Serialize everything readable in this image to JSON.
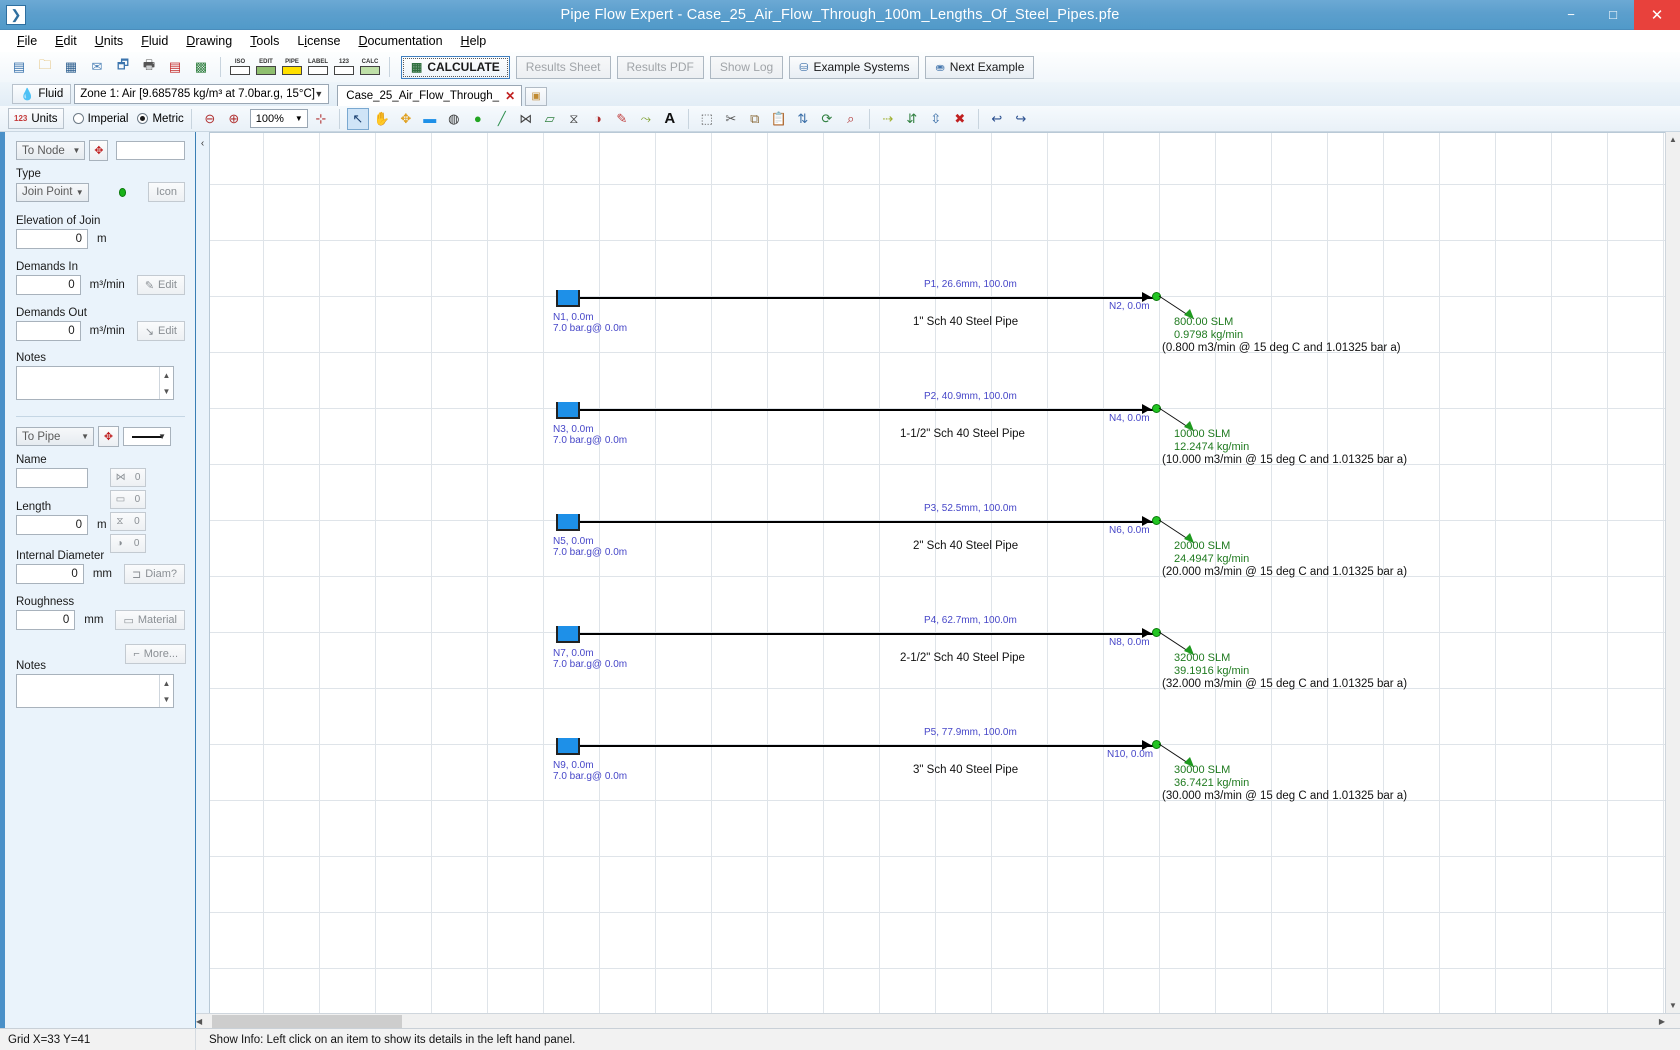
{
  "window": {
    "app_icon": "app-icon",
    "title": "Pipe Flow Expert - Case_25_Air_Flow_Through_100m_Lengths_Of_Steel_Pipes.pfe",
    "minimize": "−",
    "maximize": "□",
    "close": "✕"
  },
  "menubar": {
    "items": [
      {
        "label": "File",
        "accel": "F"
      },
      {
        "label": "Edit",
        "accel": "E"
      },
      {
        "label": "Units",
        "accel": "U"
      },
      {
        "label": "Fluid",
        "accel": "F"
      },
      {
        "label": "Drawing",
        "accel": "D"
      },
      {
        "label": "Tools",
        "accel": "T"
      },
      {
        "label": "License",
        "accel": "i"
      },
      {
        "label": "Documentation",
        "accel": "D"
      },
      {
        "label": "Help",
        "accel": "H"
      }
    ]
  },
  "toolbar": {
    "file_icons": [
      {
        "name": "new-document-icon",
        "glyph": "▤"
      },
      {
        "name": "open-folder-icon",
        "glyph": "📂"
      },
      {
        "name": "save-icon",
        "glyph": "💾"
      },
      {
        "name": "email-icon",
        "glyph": "✉"
      },
      {
        "name": "export-icon",
        "glyph": "🗔"
      },
      {
        "name": "print-icon",
        "glyph": "🖨"
      },
      {
        "name": "pdf-icon",
        "glyph": "▣"
      },
      {
        "name": "image-export-icon",
        "glyph": "🖼"
      }
    ],
    "grid_icons": [
      {
        "name": "iso-view-icon",
        "label": "ISO"
      },
      {
        "name": "edit-grid-icon",
        "label": "EDIT"
      },
      {
        "name": "pipe-grid-icon",
        "label": "PIPE"
      },
      {
        "name": "label-grid-icon",
        "label": "LABEL"
      },
      {
        "name": "numbers-grid-icon",
        "label": "123"
      },
      {
        "name": "calc-grid-icon",
        "label": "CALC"
      }
    ],
    "calculate_label": "CALCULATE",
    "results_sheet_label": "Results Sheet",
    "results_pdf_label": "Results PDF",
    "show_log_label": "Show Log",
    "example_systems_label": "Example Systems",
    "next_example_label": "Next Example"
  },
  "fluidbar": {
    "fluid_button_label": "Fluid",
    "zone_value": "Zone 1: Air [9.685785 kg/m³ at 7.0bar.g, 15°C]",
    "document_tab_label": "Case_25_Air_Flow_Through_",
    "document_tab_close": "✕",
    "new_tab_glyph": "▣"
  },
  "viewbar": {
    "units_button_label": "Units",
    "imperial_label": "Imperial",
    "metric_label": "Metric",
    "units_selected": "Metric",
    "zoom_value": "100%",
    "tools": [
      {
        "name": "zoom-out-icon",
        "glyph": "⊖"
      },
      {
        "name": "zoom-in-icon",
        "glyph": "⊕"
      },
      {
        "name": "fit-to-window-icon",
        "glyph": "⊹"
      },
      {
        "name": "select-pointer-icon",
        "glyph": "↖"
      },
      {
        "name": "pan-hand-icon",
        "glyph": "✋"
      },
      {
        "name": "move-node-icon",
        "glyph": "✥"
      },
      {
        "name": "tank-tool-icon",
        "glyph": "▬"
      },
      {
        "name": "pressure-node-icon",
        "glyph": "◍"
      },
      {
        "name": "join-point-icon",
        "glyph": "●"
      },
      {
        "name": "pipe-tool-icon",
        "glyph": "╱"
      },
      {
        "name": "valve-tool-icon",
        "glyph": "⋈"
      },
      {
        "name": "component-tool-icon",
        "glyph": "▱"
      },
      {
        "name": "fitting-tool-icon",
        "glyph": "⧖"
      },
      {
        "name": "pump-tool-icon",
        "glyph": "◑"
      },
      {
        "name": "pencil-tool-icon",
        "glyph": "✎"
      },
      {
        "name": "flow-arrow-icon",
        "glyph": "⤳"
      },
      {
        "name": "text-tool-icon",
        "glyph": "A"
      },
      {
        "name": "marquee-select-icon",
        "glyph": "⬚"
      },
      {
        "name": "cut-icon",
        "glyph": "✂"
      },
      {
        "name": "copy-icon",
        "glyph": "⧉"
      },
      {
        "name": "paste-icon",
        "glyph": "📋"
      },
      {
        "name": "mirror-icon",
        "glyph": "⇅"
      },
      {
        "name": "rotate-icon",
        "glyph": "⟳"
      },
      {
        "name": "zoom-region-icon",
        "glyph": "🔍"
      },
      {
        "name": "align-horizontal-icon",
        "glyph": "⇢"
      },
      {
        "name": "align-vertical-icon",
        "glyph": "⇵"
      },
      {
        "name": "distribute-icon",
        "glyph": "⇳"
      },
      {
        "name": "delete-icon",
        "glyph": "✖"
      },
      {
        "name": "undo-icon",
        "glyph": "↩"
      },
      {
        "name": "redo-icon",
        "glyph": "↪"
      }
    ]
  },
  "node_panel": {
    "selector_label": "To Node",
    "name_value": "",
    "type_label": "Type",
    "type_value": "Join Point",
    "icon_button_label": "Icon",
    "elevation_label": "Elevation of Join",
    "elevation_value": "0",
    "elevation_unit": "m",
    "demands_in_label": "Demands In",
    "demands_in_value": "0",
    "demands_in_unit": "m³/min",
    "demands_in_edit": "Edit",
    "demands_out_label": "Demands Out",
    "demands_out_value": "0",
    "demands_out_unit": "m³/min",
    "demands_out_edit": "Edit",
    "notes_label": "Notes",
    "notes_value": ""
  },
  "pipe_panel": {
    "selector_label": "To Pipe",
    "name_label": "Name",
    "name_value": "",
    "length_label": "Length",
    "length_value": "0",
    "length_unit": "m",
    "diameter_label": "Internal Diameter",
    "diameter_value": "0",
    "diameter_unit": "mm",
    "diameter_button": "Diam?",
    "roughness_label": "Roughness",
    "roughness_value": "0",
    "roughness_unit": "mm",
    "material_button": "Material",
    "more_button": "More...",
    "notes_label": "Notes",
    "notes_value": "",
    "counters": [
      {
        "name": "fittings-count",
        "value": "0"
      },
      {
        "name": "components-count",
        "value": "0"
      },
      {
        "name": "valves-count",
        "value": "0"
      },
      {
        "name": "pumps-count",
        "value": "0"
      }
    ]
  },
  "drawing": {
    "rows": [
      {
        "pipe_label": "P1, 26.6mm, 100.0m",
        "description": "1\" Sch 40 Steel Pipe",
        "start_node": "N1, 0.0m",
        "start_pressure": "7.0 bar.g@ 0.0m",
        "end_node": "N2, 0.0m",
        "flow_slm": "800.00 SLM",
        "flow_kgmin": "0.9798 kg/min",
        "flow_conditions": "(0.800 m3/min @ 15 deg C and 1.01325 bar a)"
      },
      {
        "pipe_label": "P2, 40.9mm, 100.0m",
        "description": "1-1/2\" Sch 40 Steel Pipe",
        "start_node": "N3, 0.0m",
        "start_pressure": "7.0 bar.g@ 0.0m",
        "end_node": "N4, 0.0m",
        "flow_slm": "10000 SLM",
        "flow_kgmin": "12.2474 kg/min",
        "flow_conditions": "(10.000 m3/min @ 15 deg C and 1.01325 bar a)"
      },
      {
        "pipe_label": "P3, 52.5mm, 100.0m",
        "description": "2\" Sch 40 Steel Pipe",
        "start_node": "N5, 0.0m",
        "start_pressure": "7.0 bar.g@ 0.0m",
        "end_node": "N6, 0.0m",
        "flow_slm": "20000 SLM",
        "flow_kgmin": "24.4947 kg/min",
        "flow_conditions": "(20.000 m3/min @ 15 deg C and 1.01325 bar a)"
      },
      {
        "pipe_label": "P4, 62.7mm, 100.0m",
        "description": "2-1/2\" Sch 40 Steel Pipe",
        "start_node": "N7, 0.0m",
        "start_pressure": "7.0 bar.g@ 0.0m",
        "end_node": "N8, 0.0m",
        "flow_slm": "32000 SLM",
        "flow_kgmin": "39.1916 kg/min",
        "flow_conditions": "(32.000 m3/min @ 15 deg C and 1.01325 bar a)"
      },
      {
        "pipe_label": "P5, 77.9mm, 100.0m",
        "description": "3\" Sch 40 Steel Pipe",
        "start_node": "N9, 0.0m",
        "start_pressure": "7.0 bar.g@ 0.0m",
        "end_node": "N10, 0.0m",
        "flow_slm": "30000 SLM",
        "flow_kgmin": "36.7421 kg/min",
        "flow_conditions": "(30.000 m3/min @ 15 deg C and 1.01325 bar a)"
      }
    ]
  },
  "statusbar": {
    "grid_text": "Grid  X=33  Y=41",
    "info_text": "Show Info: Left click on an item to show its details in the left hand panel."
  },
  "colors": {
    "titlebar": "#5c9fcd",
    "close_button": "#e8413c",
    "label_blue": "#4646c8",
    "flow_green": "#1f7a1f",
    "node_green": "#22c522",
    "tank_blue": "#1e90e8",
    "panel_bg": "#eaf3fb"
  }
}
